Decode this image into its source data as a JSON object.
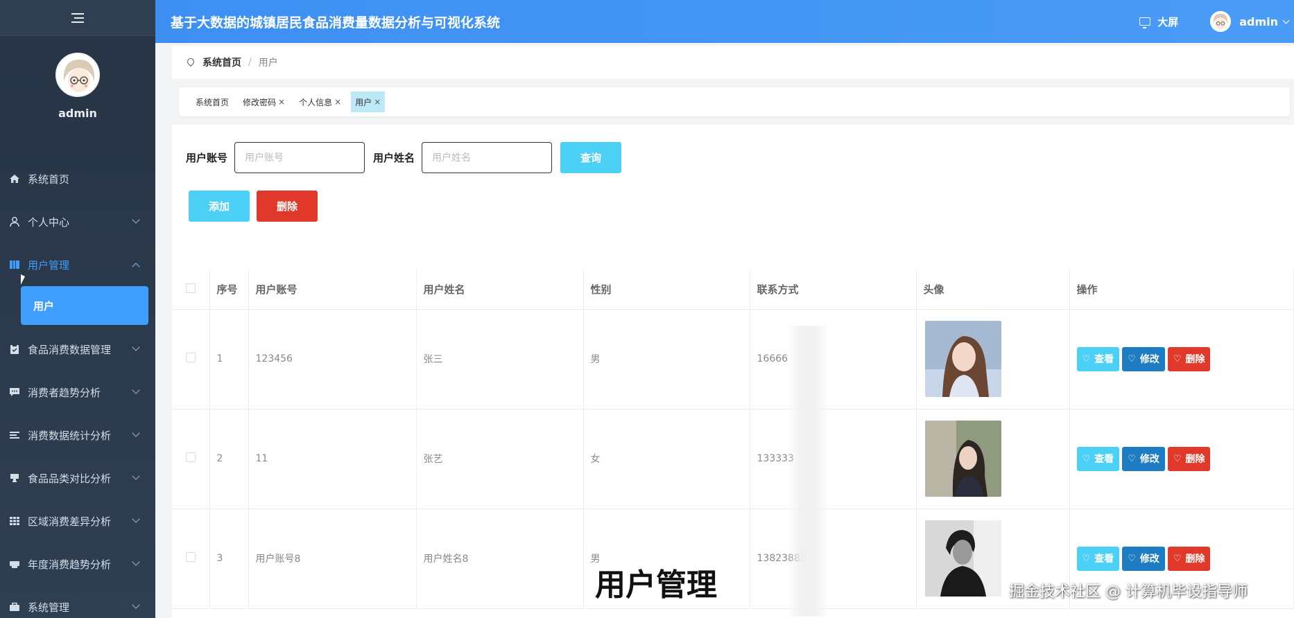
{
  "app": {
    "title": "基于大数据的城镇居民食品消费量数据分析与可视化系统"
  },
  "header": {
    "bigscreen_label": "大屏",
    "user_name": "admin"
  },
  "sidebar": {
    "profile_name": "admin",
    "items": [
      {
        "label": "系统首页",
        "icon": "home-icon"
      },
      {
        "label": "个人中心",
        "icon": "user-icon"
      },
      {
        "label": "用户管理",
        "icon": "book-icon",
        "active": true
      },
      {
        "label": "食品消费数据管理",
        "icon": "clipboard-icon"
      },
      {
        "label": "消费者趋势分析",
        "icon": "chat-icon"
      },
      {
        "label": "消费数据统计分析",
        "icon": "list-icon"
      },
      {
        "label": "食品品类对比分析",
        "icon": "cup-icon"
      },
      {
        "label": "区域消费差异分析",
        "icon": "grid-icon"
      },
      {
        "label": "年度消费趋势分析",
        "icon": "printer-icon"
      },
      {
        "label": "系统管理",
        "icon": "briefcase-icon"
      }
    ],
    "submenu": {
      "label": "用户"
    }
  },
  "breadcrumb": {
    "home": "系统首页",
    "separator": "/",
    "current": "用户"
  },
  "tags": [
    {
      "label": "系统首页",
      "closable": false
    },
    {
      "label": "修改密码",
      "closable": true
    },
    {
      "label": "个人信息",
      "closable": true
    },
    {
      "label": "用户",
      "closable": true,
      "active": true
    }
  ],
  "tag_close": "×",
  "search": {
    "account_label": "用户账号",
    "account_placeholder": "用户账号",
    "name_label": "用户姓名",
    "name_placeholder": "用户姓名",
    "query_button": "查询"
  },
  "actions": {
    "add_button": "添加",
    "delete_button": "删除"
  },
  "table": {
    "columns": [
      "序号",
      "用户账号",
      "用户姓名",
      "性别",
      "联系方式",
      "头像",
      "操作"
    ],
    "rows": [
      {
        "index": "1",
        "account": "123456",
        "name": "张三",
        "gender": "男",
        "phone": "16666"
      },
      {
        "index": "2",
        "account": "11",
        "name": "张艺",
        "gender": "女",
        "phone": "133333"
      },
      {
        "index": "3",
        "account": "用户账号8",
        "name": "用户姓名8",
        "gender": "男",
        "phone": "13823888"
      }
    ],
    "ops": {
      "view": "查看",
      "edit": "修改",
      "delete": "删除"
    }
  },
  "overlay": {
    "caption": "用户管理",
    "watermark": "掘金技术社区 @ 计算机毕设指导师"
  },
  "colors": {
    "header": "#409eff",
    "sidebar": "#263445",
    "primary": "#4dd0f5",
    "danger": "#e0392b",
    "edit": "#1e7cc2"
  }
}
